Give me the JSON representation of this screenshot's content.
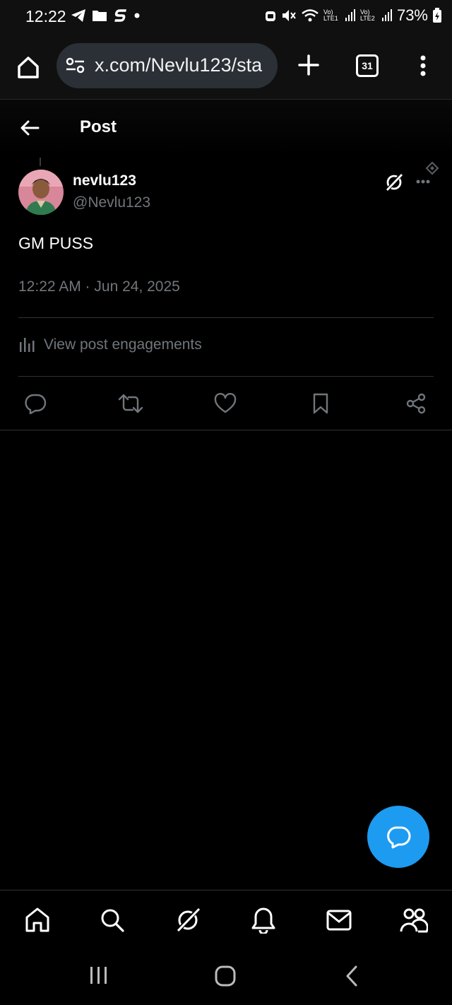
{
  "status_bar": {
    "time": "12:22",
    "battery": "73%",
    "sim1": "Vo) LTE1",
    "sim2": "Vo) LTE2",
    "icons": [
      "telegram-icon",
      "folder-icon",
      "s-app-icon",
      "dot-icon",
      "alarm-icon",
      "mute-icon",
      "wifi-icon",
      "signal-icon",
      "battery-icon"
    ]
  },
  "browser": {
    "url": "x.com/Nevlu123/sta",
    "tab_count": "31"
  },
  "header": {
    "title": "Post"
  },
  "post": {
    "display_name": "nevlu123",
    "handle": "@Nevlu123",
    "text": "GM PUSS",
    "timestamp": "12:22 AM · Jun 24, 2025",
    "engagements_label": "View post engagements"
  },
  "colors": {
    "accent": "#1d9bf0",
    "background": "#000000",
    "secondary_text": "#71767b",
    "divider": "#2f3336"
  },
  "actions": [
    "reply-icon",
    "repost-icon",
    "like-icon",
    "bookmark-icon",
    "share-icon"
  ],
  "bottom_nav": [
    "home-icon",
    "search-icon",
    "grok-icon",
    "notifications-icon",
    "messages-icon",
    "communities-icon"
  ]
}
